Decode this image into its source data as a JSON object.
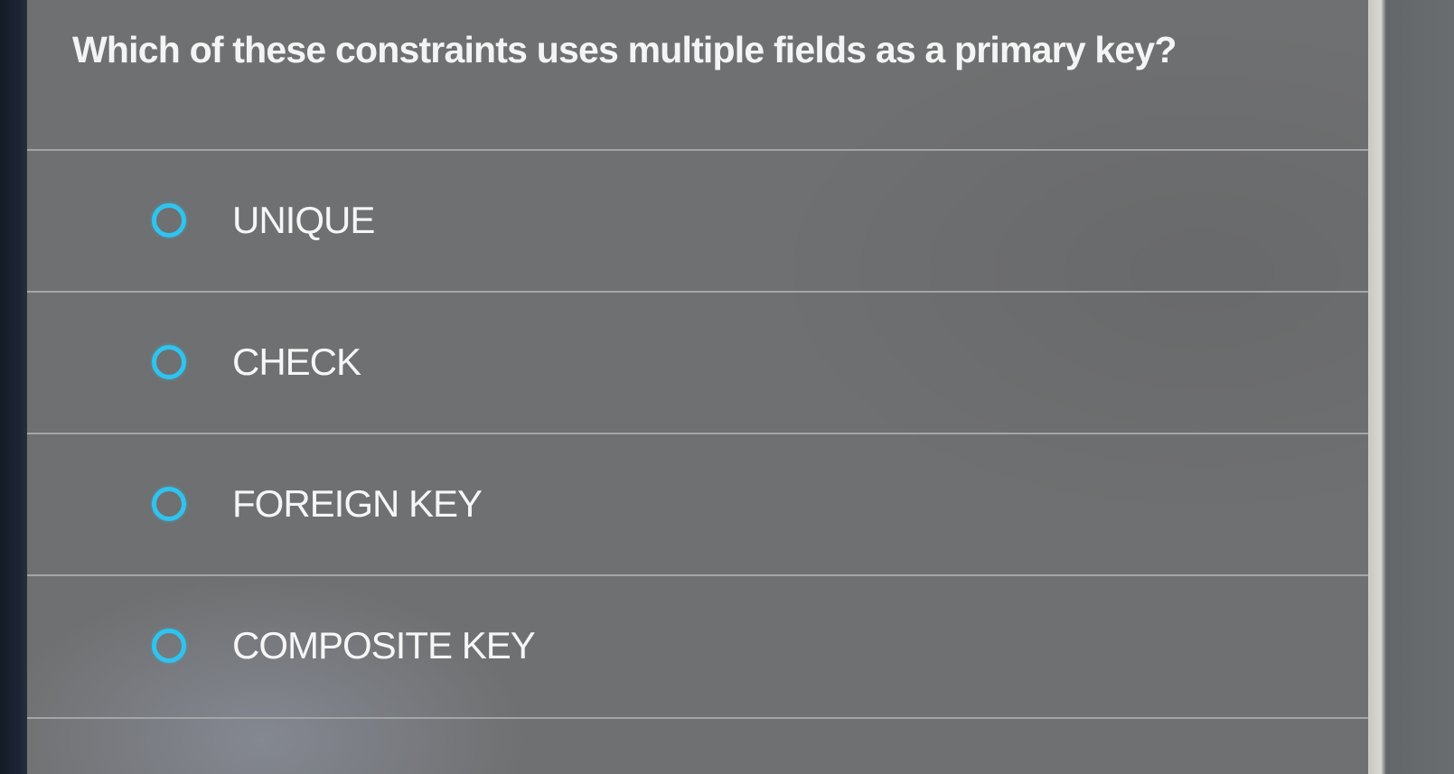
{
  "question": {
    "text": "Which of these constraints uses multiple fields as a primary key?"
  },
  "options": [
    {
      "label": "UNIQUE",
      "selected": false,
      "icon": "radio-unchecked-icon"
    },
    {
      "label": "CHECK",
      "selected": false,
      "icon": "radio-unchecked-icon"
    },
    {
      "label": "FOREIGN KEY",
      "selected": false,
      "icon": "radio-unchecked-icon"
    },
    {
      "label": "COMPOSITE KEY",
      "selected": false,
      "icon": "radio-unchecked-icon"
    }
  ],
  "colors": {
    "card_background": "#6f7071",
    "radio_accent": "#2ec4f0",
    "text": "#f4f4f4",
    "divider": "#a4a5a7"
  }
}
